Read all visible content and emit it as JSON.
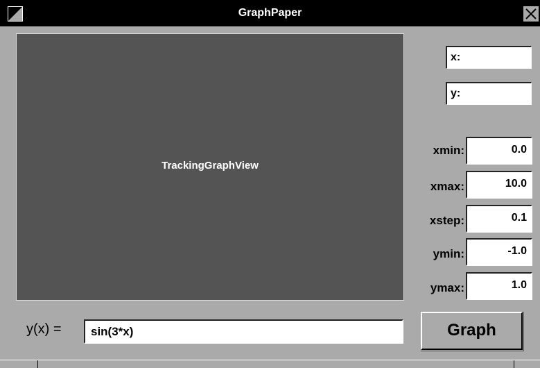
{
  "window": {
    "title": "GraphPaper"
  },
  "titlebar": {
    "miniaturize_icon": "miniaturize-icon",
    "close_icon": "close-icon"
  },
  "graph_view": {
    "label": "TrackingGraphView"
  },
  "readouts": {
    "x_label": "x:",
    "y_label": "y:"
  },
  "params": {
    "xmin": {
      "label": "xmin:",
      "value": "0.0"
    },
    "xmax": {
      "label": "xmax:",
      "value": "10.0"
    },
    "xstep": {
      "label": "xstep:",
      "value": "0.1"
    },
    "ymin": {
      "label": "ymin:",
      "value": "-1.0"
    },
    "ymax": {
      "label": "ymax:",
      "value": "1.0"
    }
  },
  "function": {
    "label": "y(x) =",
    "value": "sin(3*x)"
  },
  "graph_button": {
    "label": "Graph"
  },
  "colors": {
    "titlebar": "#000000",
    "window_bg": "#aaaaaa",
    "graph_view_bg": "#545454",
    "field_bg": "#ffffff"
  }
}
